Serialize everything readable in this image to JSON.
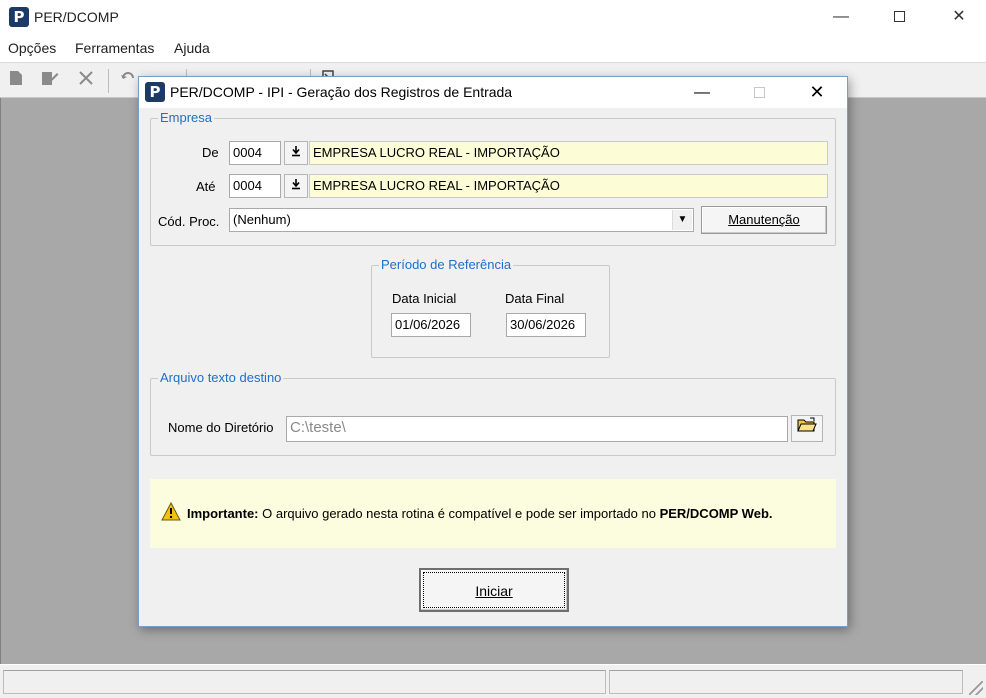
{
  "app": {
    "title": "PER/DCOMP",
    "logo_letter": "P",
    "controls": {
      "minimize": "—",
      "close": "✕"
    }
  },
  "menu": [
    "Opções",
    "Ferramentas",
    "Ajuda"
  ],
  "dialog": {
    "title": "PER/DCOMP - IPI - Geração dos Registros de Entrada",
    "logo_letter": "P",
    "controls": {
      "minimize": "—",
      "close": "✕"
    },
    "empresa": {
      "legend": "Empresa",
      "de_label": "De",
      "de_code": "0004",
      "de_name": "EMPRESA LUCRO REAL - IMPORTAÇÃO",
      "ate_label": "Até",
      "ate_code": "0004",
      "ate_name": "EMPRESA LUCRO REAL - IMPORTAÇÃO",
      "cod_proc_label": "Cód. Proc.",
      "cod_proc_value": "(Nenhum)",
      "manutencao_button": "Manutenção",
      "lookup_icon": "down-arrow-bar-icon"
    },
    "periodo": {
      "legend": "Período de Referência",
      "data_inicial_label": "Data Inicial",
      "data_inicial_value": "01/06/2026",
      "data_final_label": "Data Final",
      "data_final_value": "30/06/2026"
    },
    "arquivo": {
      "legend": "Arquivo texto destino",
      "diretorio_label": "Nome do Diretório",
      "diretorio_value": "C:\\teste\\",
      "browse_icon": "open-folder-icon"
    },
    "info": {
      "icon": "warning-icon",
      "bold_prefix": "Importante:",
      "text": " O arquivo gerado nesta rotina é compatível e pode ser importado no ",
      "bold_suffix": "PER/DCOMP Web."
    },
    "iniciar_button": "Iniciar"
  },
  "colors": {
    "legend_blue": "#1e6fc5",
    "yellow_field": "#fcfcd6",
    "info_background": "#fcfcde",
    "workspace_gray": "#a8a8a8",
    "logo_navy": "#1c3a66"
  }
}
